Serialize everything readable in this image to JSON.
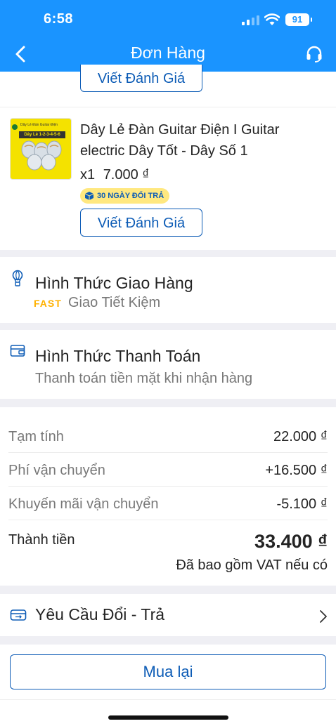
{
  "status_bar": {
    "time": "6:58",
    "battery": "91"
  },
  "nav": {
    "title": "Đơn Hàng",
    "back_icon": "chevron-left-icon",
    "support_icon": "headset-icon"
  },
  "items": [
    {
      "review_label": "Viết Đánh Giá"
    },
    {
      "name": "Dây Lẻ Đàn Guitar Điện I Guitar electric Dây Tốt  - Dây Số 1",
      "thumb_text_top": "Dây Lẻ Đàn Guitar Điện",
      "thumb_text_main": "Dây Lẻ 1-2-3-4-5-6",
      "quantity": "x1",
      "price": "7.000 ₫",
      "badge": "30 NGÀY ĐỔI TRẢ",
      "review_label": "Viết Đánh Giá"
    }
  ],
  "shipping": {
    "title": "Hình Thức Giao Hàng",
    "tag": "FAST",
    "method": "Giao Tiết Kiệm"
  },
  "payment": {
    "title": "Hình Thức Thanh Toán",
    "method": "Thanh toán tiền mặt khi nhận hàng"
  },
  "summary": {
    "rows": [
      {
        "label": "Tạm tính",
        "value": "22.000 ₫"
      },
      {
        "label": "Phí vận chuyển",
        "value": "+16.500 ₫"
      },
      {
        "label": "Khuyến mãi vận chuyển",
        "value": "-5.100 ₫"
      }
    ],
    "total_label": "Thành tiền",
    "total_value": "33.400 ₫",
    "vat_note": "Đã bao gồm VAT nếu có"
  },
  "return_request": {
    "label": "Yêu Cầu Đổi - Trả"
  },
  "rebuy": {
    "label": "Mua lại"
  },
  "colors": {
    "brand_blue": "#1a94ff",
    "link_blue": "#0d5cb6",
    "fast_yellow": "#ffb100",
    "badge_yellow": "#ffe880"
  }
}
